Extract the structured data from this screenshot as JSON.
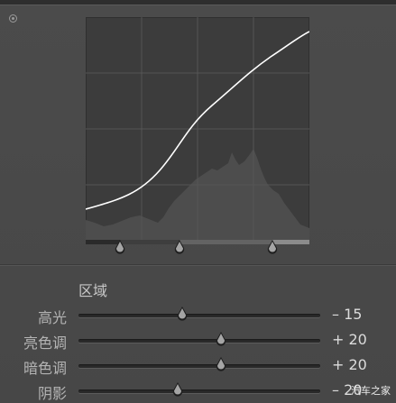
{
  "panel": {
    "target_icon": "target-adjust-icon",
    "section_title": "区域"
  },
  "tone_curve": {
    "curve_color": "#ffffff",
    "grid_color": "#555555"
  },
  "split_handles": [
    "shadows-split-handle",
    "midtones-split-handle",
    "highlights-split-handle"
  ],
  "sliders": [
    {
      "label": "高光",
      "value": "– 15",
      "position": 0.43
    },
    {
      "label": "亮色调",
      "value": "+ 20",
      "position": 0.59
    },
    {
      "label": "暗色调",
      "value": "+ 20",
      "position": 0.59
    },
    {
      "label": "阴影",
      "value": "– 20",
      "position": 0.41
    }
  ],
  "watermark": "汽车之家"
}
